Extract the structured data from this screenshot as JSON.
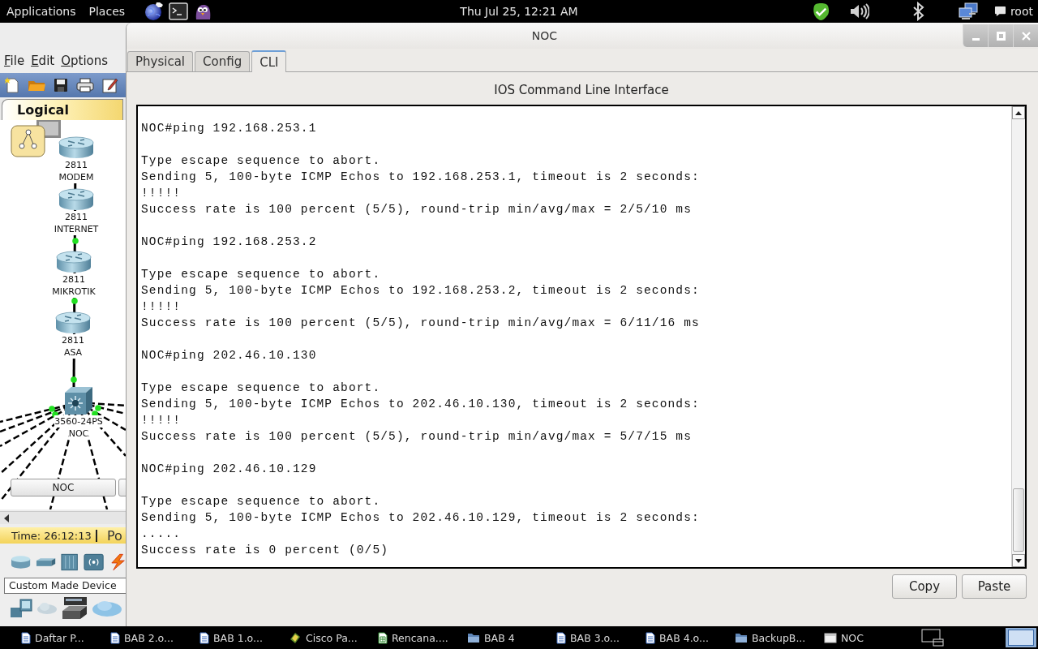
{
  "top_panel": {
    "menus": [
      "Applications",
      "Places"
    ],
    "clock": "Thu Jul 25, 12:21 AM",
    "user": "root"
  },
  "packet_tracer": {
    "menu": [
      "File",
      "Edit",
      "Options"
    ],
    "workspace_tab": "Logical",
    "devices": [
      {
        "kind": "router",
        "model": "2811",
        "name": "MODEM"
      },
      {
        "kind": "router",
        "model": "2811",
        "name": "INTERNET"
      },
      {
        "kind": "router",
        "model": "2811",
        "name": "MIKROTIK"
      },
      {
        "kind": "router",
        "model": "2811",
        "name": "ASA"
      },
      {
        "kind": "switch",
        "model": "3560-24PS",
        "name": "NOC"
      }
    ],
    "device_button": "NOC",
    "time": "Time: 26:12:13",
    "mode_tab": "Po",
    "device_category": "Custom Made Device"
  },
  "window": {
    "title": "NOC",
    "tabs": [
      {
        "label": "Physical",
        "selected": false
      },
      {
        "label": "Config",
        "selected": false
      },
      {
        "label": "CLI",
        "selected": true
      }
    ],
    "heading": "IOS Command Line Interface",
    "cli": [
      {
        "command": "NOC#ping 192.168.253.1",
        "output": [
          "Type escape sequence to abort.",
          "Sending 5, 100-byte ICMP Echos to 192.168.253.1, timeout is 2 seconds:",
          "!!!!!",
          "Success rate is 100 percent (5/5), round-trip min/avg/max = 2/5/10 ms"
        ]
      },
      {
        "command": "NOC#ping 192.168.253.2",
        "output": [
          "Type escape sequence to abort.",
          "Sending 5, 100-byte ICMP Echos to 192.168.253.2, timeout is 2 seconds:",
          "!!!!!",
          "Success rate is 100 percent (5/5), round-trip min/avg/max = 6/11/16 ms"
        ]
      },
      {
        "command": "NOC#ping 202.46.10.130",
        "output": [
          "Type escape sequence to abort.",
          "Sending 5, 100-byte ICMP Echos to 202.46.10.130, timeout is 2 seconds:",
          "!!!!!",
          "Success rate is 100 percent (5/5), round-trip min/avg/max = 5/7/15 ms"
        ]
      },
      {
        "command": "NOC#ping 202.46.10.129",
        "output": [
          "Type escape sequence to abort.",
          "Sending 5, 100-byte ICMP Echos to 202.46.10.129, timeout is 2 seconds:",
          ".....",
          "Success rate is 0 percent (0/5)"
        ]
      }
    ],
    "buttons": [
      "Copy",
      "Paste"
    ]
  },
  "taskbar": {
    "items": [
      {
        "kind": "document",
        "label": "Daftar P..."
      },
      {
        "kind": "document",
        "label": "BAB 2.o..."
      },
      {
        "kind": "document",
        "label": "BAB 1.o..."
      },
      {
        "kind": "app",
        "label": "Cisco Pa..."
      },
      {
        "kind": "spreadsheet",
        "label": "Rencana...."
      },
      {
        "kind": "folder",
        "label": "BAB 4"
      },
      {
        "kind": "document",
        "label": "BAB 3.o..."
      },
      {
        "kind": "document",
        "label": "BAB 4.o..."
      },
      {
        "kind": "folder",
        "label": "BackupB..."
      },
      {
        "kind": "window",
        "label": "NOC"
      }
    ]
  }
}
